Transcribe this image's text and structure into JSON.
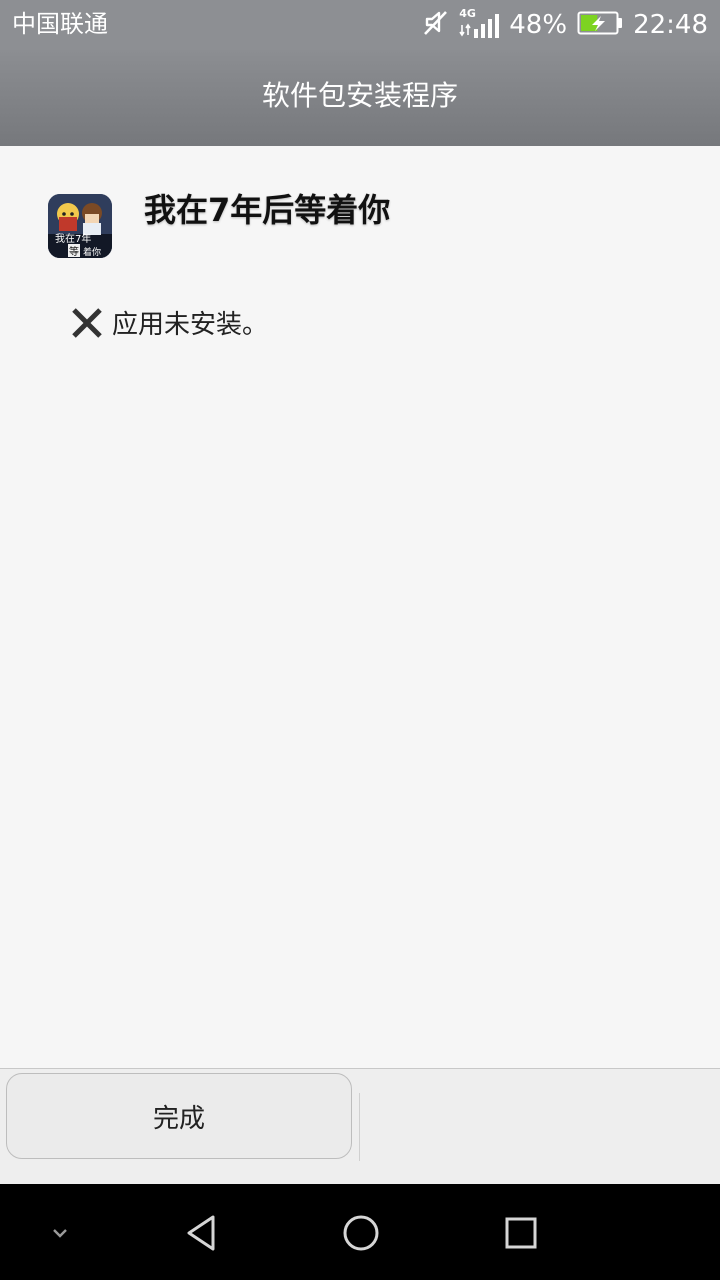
{
  "status_bar": {
    "carrier": "中国联通",
    "network": "4G",
    "battery_percent": "48%",
    "time": "22:48",
    "icons": [
      "mute-icon",
      "signal-icon",
      "battery-charging-icon"
    ],
    "battery_level": 0.48,
    "battery_color": "#7dd321"
  },
  "titlebar": {
    "title": "软件包安装程序"
  },
  "app": {
    "name": "我在7年后等着你",
    "icon": "app-icon",
    "icon_text_1": "我在7年",
    "icon_text_2": "等",
    "icon_text_3": "着你"
  },
  "install_status": {
    "icon": "close-icon",
    "message": "应用未安装。"
  },
  "footer": {
    "done_label": "完成"
  },
  "nav_bar": {
    "icons": [
      "hide-nav-icon",
      "back-icon",
      "home-icon",
      "recents-icon"
    ]
  }
}
